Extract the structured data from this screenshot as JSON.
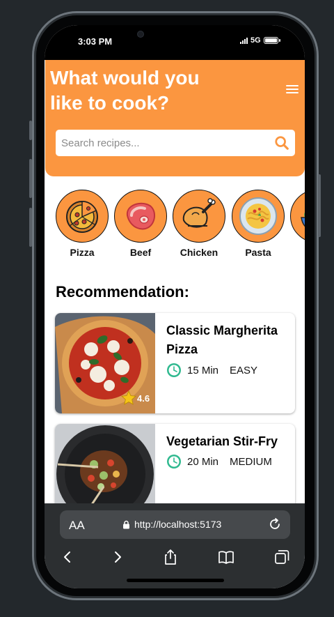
{
  "status_bar": {
    "time": "3:03 PM",
    "network": "5G"
  },
  "header": {
    "title": "What would you like to cook?"
  },
  "search": {
    "placeholder": "Search recipes..."
  },
  "categories": [
    {
      "label": "Pizza",
      "icon": "pizza-icon"
    },
    {
      "label": "Beef",
      "icon": "steak-icon"
    },
    {
      "label": "Chicken",
      "icon": "chicken-icon"
    },
    {
      "label": "Pasta",
      "icon": "pasta-icon"
    },
    {
      "label": "S",
      "icon": "salad-icon"
    }
  ],
  "recommendation": {
    "title": "Recommendation:",
    "recipes": [
      {
        "title": "Classic Margherita Pizza",
        "time": "15 Min",
        "difficulty": "EASY",
        "rating": "4.6"
      },
      {
        "title": "Vegetarian Stir-Fry",
        "time": "20 Min",
        "difficulty": "MEDIUM",
        "rating": ""
      }
    ]
  },
  "browser": {
    "aa_label": "AA",
    "url": "http://localhost:5173"
  },
  "colors": {
    "accent": "#fb9640",
    "clock": "#2fb98f"
  }
}
